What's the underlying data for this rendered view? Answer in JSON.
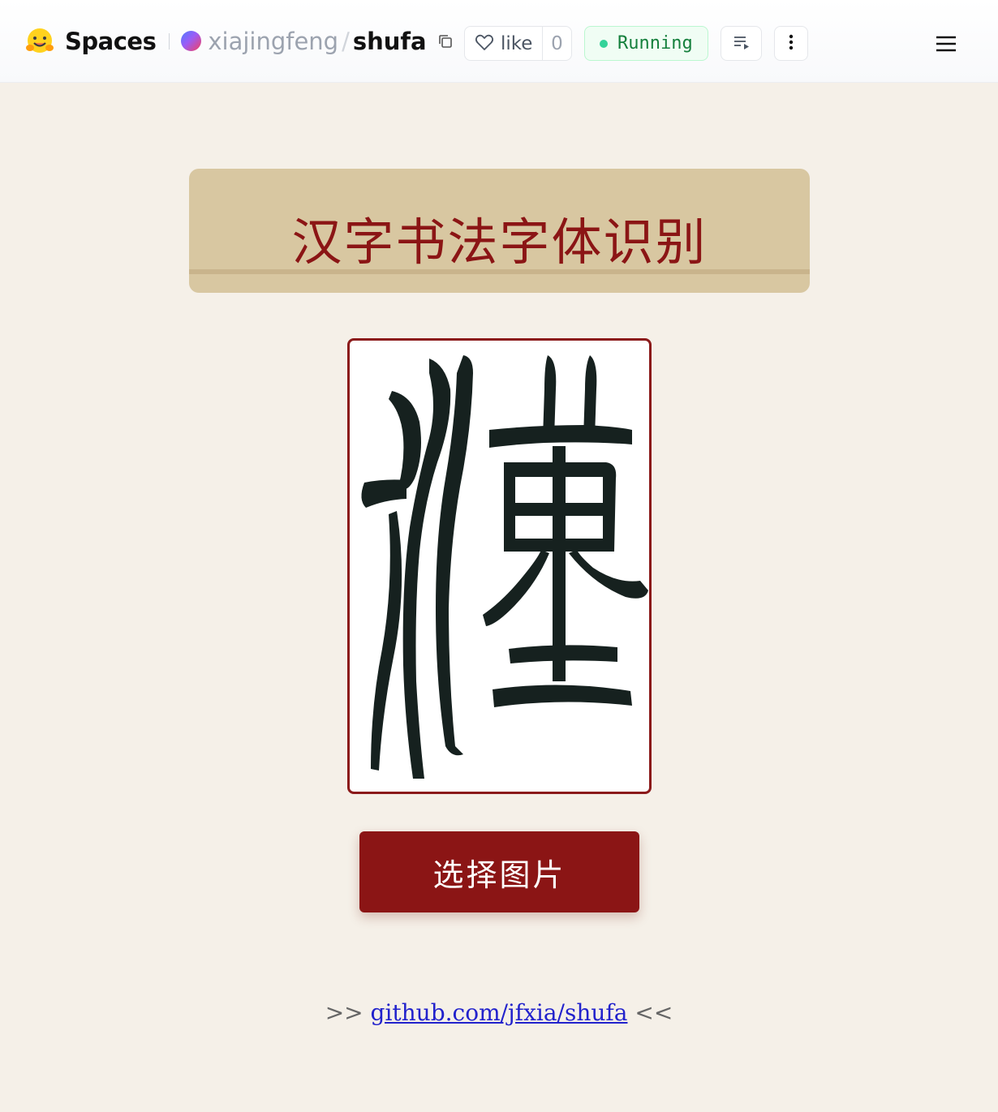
{
  "header": {
    "brand": "Spaces",
    "owner": "xiajingfeng",
    "separator": "/",
    "repo": "shufa",
    "like_label": "like",
    "like_count": "0",
    "status": "Running",
    "status_color": "#34d399"
  },
  "main": {
    "title": "汉字书法字体识别",
    "select_button": "选择图片",
    "title_color": "#8b1515",
    "button_color": "#8b1515"
  },
  "footer": {
    "prefix": ">>",
    "link": "github.com/jfxia/shufa",
    "suffix": "<<"
  },
  "icons": {
    "logo": "hugging-face-icon",
    "copy": "copy-icon",
    "like": "heart-icon",
    "playlist": "playlist-icon",
    "more": "more-vertical-icon",
    "menu": "hamburger-menu-icon"
  }
}
